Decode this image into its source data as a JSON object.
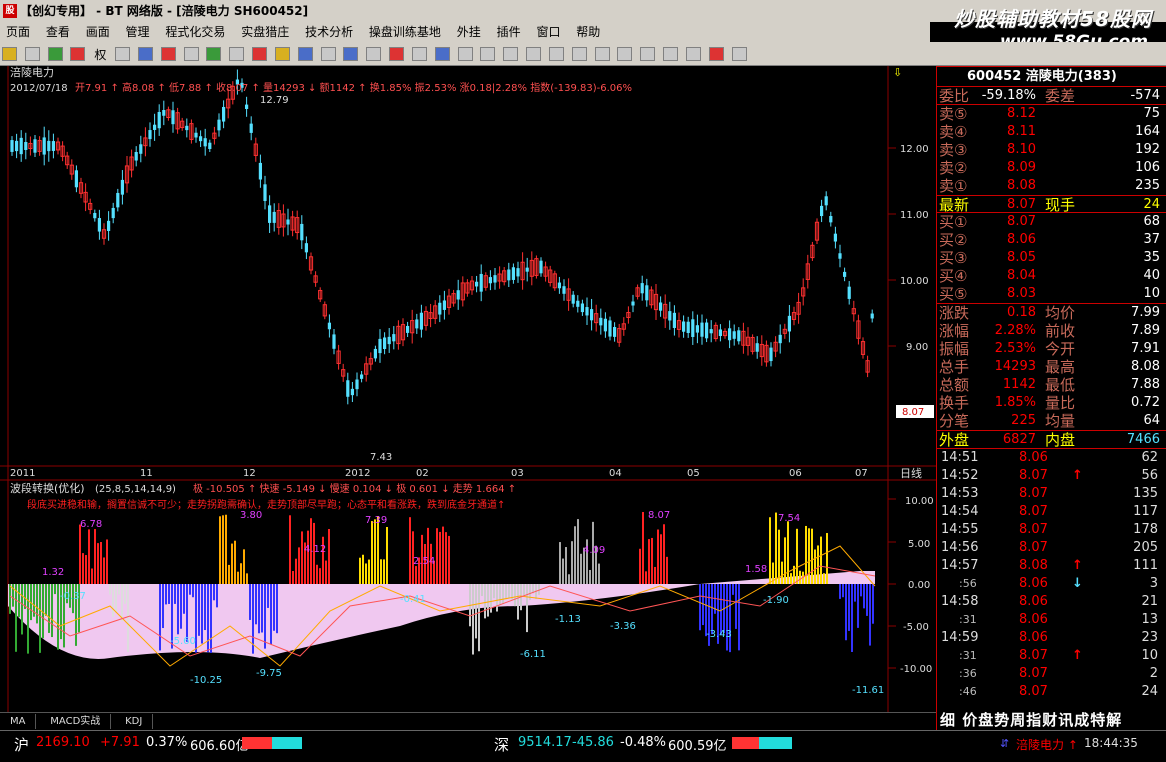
{
  "window": {
    "title": "【创幻专用】 - BT 网络版 - [涪陵电力 SH600452]"
  },
  "watermark": {
    "line1": "炒股辅助教材58股网",
    "line2": "www.58Gu.com"
  },
  "menu": [
    "页面",
    "查看",
    "画面",
    "管理",
    "程式化交易",
    "实盘猎庄",
    "技术分析",
    "操盘训练基地",
    "外挂",
    "插件",
    "窗口",
    "帮助"
  ],
  "toolbar": {
    "quan_label": "权"
  },
  "chart": {
    "stock_name": "涪陵电力",
    "info_date": "2012/07/18",
    "info_line": "开7.91 ↑ 高8.08 ↑ 低7.88 ↑ 收8.07 ↑ 量14293 ↓ 额1142 ↑ 换1.85% 振2.53% 涨0.18|2.28% 指数(-139.83)-6.06%",
    "price_ticks": [
      "12.00",
      "11.00",
      "10.00",
      "9.00"
    ],
    "last_price": "8.07",
    "high_label": "12.79",
    "low_label": "7.43",
    "time_axis": [
      "2011",
      "11",
      "12",
      "2012",
      "02",
      "03",
      "04",
      "05",
      "06",
      "07"
    ],
    "period_label": "日线",
    "ind_title": "波段转换(优化)",
    "ind_params": "(25,8,5,14,14,9)",
    "ind_values": "极 -10.505 ↑ 快速 -5.149 ↓ 慢速 0.104 ↓ 极 0.601 ↓ 走势 1.664 ↑",
    "ind_note": "段底买进稳和输，搁置信诚不可少；走势拐跑需确认，走势顶部尽早跑；心态平和看涨跌，跌到底金牙通道↑",
    "ind_ticks": [
      "10.00",
      "5.00",
      "0.00",
      "-5.00",
      "-10.00"
    ],
    "ind_labels": [
      "1.32",
      "6.78",
      "-0.37",
      "-5.60",
      "-10.25",
      "3.80",
      "-9.75",
      "4.12",
      "7.39",
      "2.54",
      "-0.41",
      "-6.11",
      "4.09",
      "-1.13",
      "-3.36",
      "8.07",
      "-3.43",
      "1.58",
      "7.54",
      "-1.90",
      "-11.61"
    ]
  },
  "quote": {
    "header": "600452 涪陵电力(383)",
    "weibi": {
      "label": "委比",
      "value": "-59.18%",
      "label2": "委差",
      "value2": "-574"
    },
    "sells": [
      {
        "label": "卖⑤",
        "price": "8.12",
        "vol": "75"
      },
      {
        "label": "卖④",
        "price": "8.11",
        "vol": "164"
      },
      {
        "label": "卖③",
        "price": "8.10",
        "vol": "192"
      },
      {
        "label": "卖②",
        "price": "8.09",
        "vol": "106"
      },
      {
        "label": "卖①",
        "price": "8.08",
        "vol": "235"
      }
    ],
    "latest": {
      "label": "最新",
      "price": "8.07",
      "label2": "现手",
      "vol": "24"
    },
    "buys": [
      {
        "label": "买①",
        "price": "8.07",
        "vol": "68"
      },
      {
        "label": "买②",
        "price": "8.06",
        "vol": "37"
      },
      {
        "label": "买③",
        "price": "8.05",
        "vol": "35"
      },
      {
        "label": "买④",
        "price": "8.04",
        "vol": "40"
      },
      {
        "label": "买⑤",
        "price": "8.03",
        "vol": "10"
      }
    ],
    "stats": [
      {
        "label": "涨跌",
        "value": "0.18",
        "label2": "均价",
        "value2": "7.99"
      },
      {
        "label": "涨幅",
        "value": "2.28%",
        "label2": "前收",
        "value2": "7.89"
      },
      {
        "label": "振幅",
        "value": "2.53%",
        "label2": "今开",
        "value2": "7.91"
      },
      {
        "label": "总手",
        "value": "14293",
        "label2": "最高",
        "value2": "8.08"
      },
      {
        "label": "总额",
        "value": "1142",
        "label2": "最低",
        "value2": "7.88"
      },
      {
        "label": "换手",
        "value": "1.85%",
        "label2": "量比",
        "value2": "0.72"
      },
      {
        "label": "分笔",
        "value": "225",
        "label2": "均量",
        "value2": "64"
      }
    ],
    "outer": {
      "label": "外盘",
      "value": "6827",
      "label2": "内盘",
      "value2": "7466"
    },
    "ticks": [
      {
        "time": "14:51",
        "price": "8.06",
        "arrow": "",
        "vol": "62"
      },
      {
        "time": "14:52",
        "price": "8.07",
        "arrow": "↑",
        "vol": "56"
      },
      {
        "time": "14:53",
        "price": "8.07",
        "arrow": "",
        "vol": "135"
      },
      {
        "time": "14:54",
        "price": "8.07",
        "arrow": "",
        "vol": "117"
      },
      {
        "time": "14:55",
        "price": "8.07",
        "arrow": "",
        "vol": "178"
      },
      {
        "time": "14:56",
        "price": "8.07",
        "arrow": "",
        "vol": "205"
      },
      {
        "time": "14:57",
        "price": "8.08",
        "arrow": "↑",
        "vol": "111"
      },
      {
        "time": ":56",
        "price": "8.06",
        "arrow": "↓",
        "vol": "3"
      },
      {
        "time": "14:58",
        "price": "8.06",
        "arrow": "",
        "vol": "21"
      },
      {
        "time": ":31",
        "price": "8.06",
        "arrow": "",
        "vol": "13"
      },
      {
        "time": "14:59",
        "price": "8.06",
        "arrow": "",
        "vol": "23"
      },
      {
        "time": ":31",
        "price": "8.07",
        "arrow": "↑",
        "vol": "10"
      },
      {
        "time": ":36",
        "price": "8.07",
        "arrow": "",
        "vol": "2"
      },
      {
        "time": ":46",
        "price": "8.07",
        "arrow": "",
        "vol": "24"
      }
    ],
    "bottom": "细 价盘势周指财讯成特解"
  },
  "tabs": [
    "MA",
    "MACD实战",
    "KDJ"
  ],
  "status": {
    "sh_label": "沪",
    "sh_index": "2169.10",
    "sh_change": "+7.91",
    "sh_pct": "0.37%",
    "sh_amt": "606.60亿",
    "sz_label": "深",
    "sz_index": "9514.17",
    "sz_change": "-45.86",
    "sz_pct": "-0.48%",
    "sz_amt": "600.59亿",
    "stock": "涪陵电力 ↑",
    "clock": "18:44:35"
  },
  "colors": {
    "up": "#ff3030",
    "down": "#55e0ff",
    "grid": "#8b0000",
    "accent": "#ffff00"
  }
}
